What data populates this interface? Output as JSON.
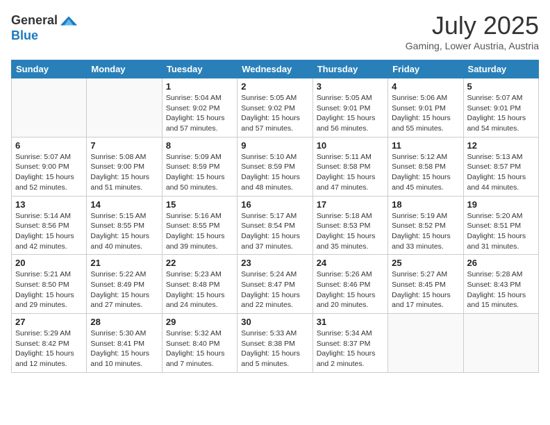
{
  "header": {
    "logo_general": "General",
    "logo_blue": "Blue",
    "month_year": "July 2025",
    "location": "Gaming, Lower Austria, Austria"
  },
  "days_of_week": [
    "Sunday",
    "Monday",
    "Tuesday",
    "Wednesday",
    "Thursday",
    "Friday",
    "Saturday"
  ],
  "weeks": [
    [
      {
        "day": "",
        "info": ""
      },
      {
        "day": "",
        "info": ""
      },
      {
        "day": "1",
        "info": "Sunrise: 5:04 AM\nSunset: 9:02 PM\nDaylight: 15 hours\nand 57 minutes."
      },
      {
        "day": "2",
        "info": "Sunrise: 5:05 AM\nSunset: 9:02 PM\nDaylight: 15 hours\nand 57 minutes."
      },
      {
        "day": "3",
        "info": "Sunrise: 5:05 AM\nSunset: 9:01 PM\nDaylight: 15 hours\nand 56 minutes."
      },
      {
        "day": "4",
        "info": "Sunrise: 5:06 AM\nSunset: 9:01 PM\nDaylight: 15 hours\nand 55 minutes."
      },
      {
        "day": "5",
        "info": "Sunrise: 5:07 AM\nSunset: 9:01 PM\nDaylight: 15 hours\nand 54 minutes."
      }
    ],
    [
      {
        "day": "6",
        "info": "Sunrise: 5:07 AM\nSunset: 9:00 PM\nDaylight: 15 hours\nand 52 minutes."
      },
      {
        "day": "7",
        "info": "Sunrise: 5:08 AM\nSunset: 9:00 PM\nDaylight: 15 hours\nand 51 minutes."
      },
      {
        "day": "8",
        "info": "Sunrise: 5:09 AM\nSunset: 8:59 PM\nDaylight: 15 hours\nand 50 minutes."
      },
      {
        "day": "9",
        "info": "Sunrise: 5:10 AM\nSunset: 8:59 PM\nDaylight: 15 hours\nand 48 minutes."
      },
      {
        "day": "10",
        "info": "Sunrise: 5:11 AM\nSunset: 8:58 PM\nDaylight: 15 hours\nand 47 minutes."
      },
      {
        "day": "11",
        "info": "Sunrise: 5:12 AM\nSunset: 8:58 PM\nDaylight: 15 hours\nand 45 minutes."
      },
      {
        "day": "12",
        "info": "Sunrise: 5:13 AM\nSunset: 8:57 PM\nDaylight: 15 hours\nand 44 minutes."
      }
    ],
    [
      {
        "day": "13",
        "info": "Sunrise: 5:14 AM\nSunset: 8:56 PM\nDaylight: 15 hours\nand 42 minutes."
      },
      {
        "day": "14",
        "info": "Sunrise: 5:15 AM\nSunset: 8:55 PM\nDaylight: 15 hours\nand 40 minutes."
      },
      {
        "day": "15",
        "info": "Sunrise: 5:16 AM\nSunset: 8:55 PM\nDaylight: 15 hours\nand 39 minutes."
      },
      {
        "day": "16",
        "info": "Sunrise: 5:17 AM\nSunset: 8:54 PM\nDaylight: 15 hours\nand 37 minutes."
      },
      {
        "day": "17",
        "info": "Sunrise: 5:18 AM\nSunset: 8:53 PM\nDaylight: 15 hours\nand 35 minutes."
      },
      {
        "day": "18",
        "info": "Sunrise: 5:19 AM\nSunset: 8:52 PM\nDaylight: 15 hours\nand 33 minutes."
      },
      {
        "day": "19",
        "info": "Sunrise: 5:20 AM\nSunset: 8:51 PM\nDaylight: 15 hours\nand 31 minutes."
      }
    ],
    [
      {
        "day": "20",
        "info": "Sunrise: 5:21 AM\nSunset: 8:50 PM\nDaylight: 15 hours\nand 29 minutes."
      },
      {
        "day": "21",
        "info": "Sunrise: 5:22 AM\nSunset: 8:49 PM\nDaylight: 15 hours\nand 27 minutes."
      },
      {
        "day": "22",
        "info": "Sunrise: 5:23 AM\nSunset: 8:48 PM\nDaylight: 15 hours\nand 24 minutes."
      },
      {
        "day": "23",
        "info": "Sunrise: 5:24 AM\nSunset: 8:47 PM\nDaylight: 15 hours\nand 22 minutes."
      },
      {
        "day": "24",
        "info": "Sunrise: 5:26 AM\nSunset: 8:46 PM\nDaylight: 15 hours\nand 20 minutes."
      },
      {
        "day": "25",
        "info": "Sunrise: 5:27 AM\nSunset: 8:45 PM\nDaylight: 15 hours\nand 17 minutes."
      },
      {
        "day": "26",
        "info": "Sunrise: 5:28 AM\nSunset: 8:43 PM\nDaylight: 15 hours\nand 15 minutes."
      }
    ],
    [
      {
        "day": "27",
        "info": "Sunrise: 5:29 AM\nSunset: 8:42 PM\nDaylight: 15 hours\nand 12 minutes."
      },
      {
        "day": "28",
        "info": "Sunrise: 5:30 AM\nSunset: 8:41 PM\nDaylight: 15 hours\nand 10 minutes."
      },
      {
        "day": "29",
        "info": "Sunrise: 5:32 AM\nSunset: 8:40 PM\nDaylight: 15 hours\nand 7 minutes."
      },
      {
        "day": "30",
        "info": "Sunrise: 5:33 AM\nSunset: 8:38 PM\nDaylight: 15 hours\nand 5 minutes."
      },
      {
        "day": "31",
        "info": "Sunrise: 5:34 AM\nSunset: 8:37 PM\nDaylight: 15 hours\nand 2 minutes."
      },
      {
        "day": "",
        "info": ""
      },
      {
        "day": "",
        "info": ""
      }
    ]
  ]
}
